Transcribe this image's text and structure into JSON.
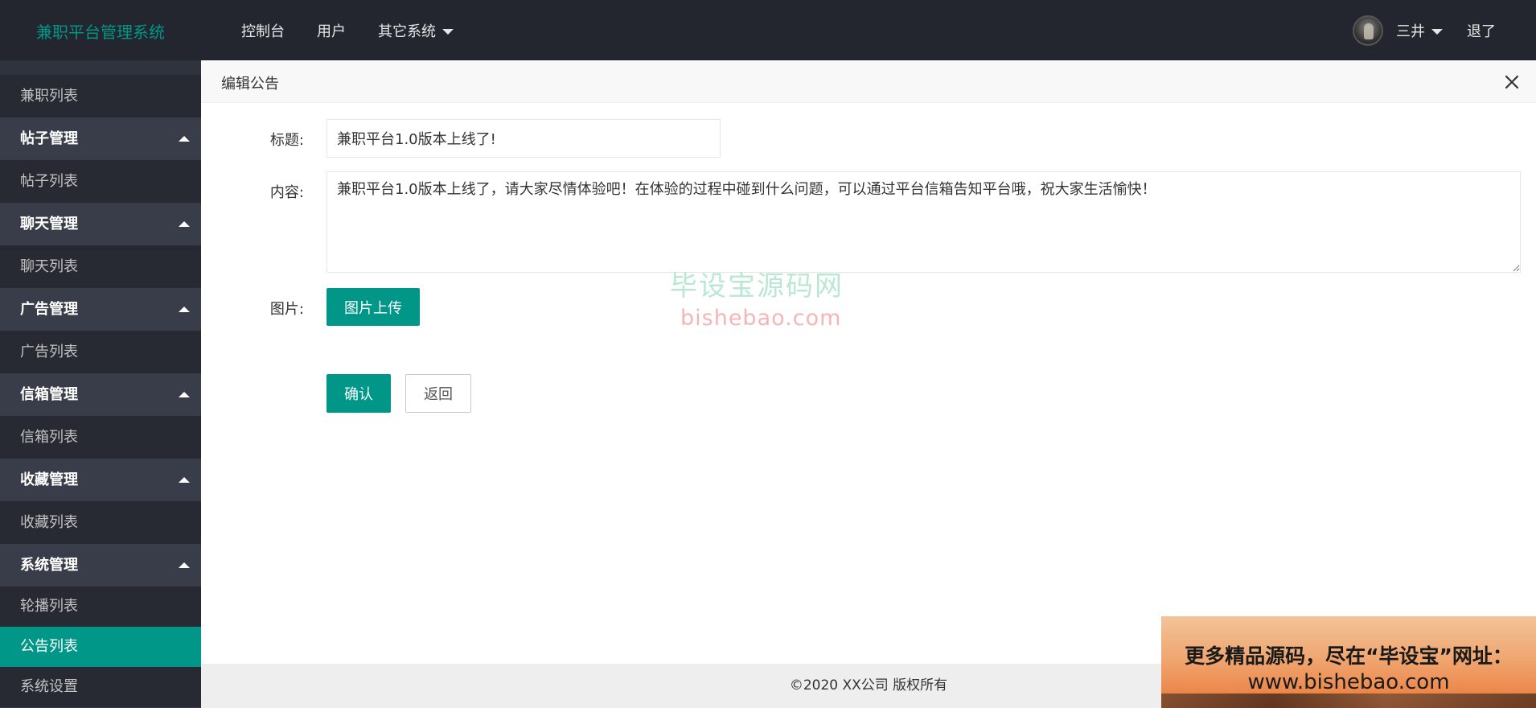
{
  "header": {
    "logo_text": "兼职平台管理系统",
    "nav": [
      {
        "label": "控制台"
      },
      {
        "label": "用户"
      },
      {
        "label": "其它系统"
      }
    ],
    "user_name": "三井",
    "logout_label": "退了"
  },
  "sidebar": {
    "items": [
      {
        "label": "兼职列表"
      },
      {
        "label": "帖子管理"
      },
      {
        "label": "帖子列表"
      },
      {
        "label": "聊天管理"
      },
      {
        "label": "聊天列表"
      },
      {
        "label": "广告管理"
      },
      {
        "label": "广告列表"
      },
      {
        "label": "信箱管理"
      },
      {
        "label": "信箱列表"
      },
      {
        "label": "收藏管理"
      },
      {
        "label": "收藏列表"
      },
      {
        "label": "系统管理"
      },
      {
        "label": "轮播列表"
      },
      {
        "label": "公告列表"
      },
      {
        "label": "系统设置"
      }
    ]
  },
  "panel": {
    "title": "编辑公告",
    "form": {
      "title_label": "标题:",
      "title_value": "兼职平台1.0版本上线了!",
      "content_label": "内容:",
      "content_value": "兼职平台1.0版本上线了，请大家尽情体验吧！在体验的过程中碰到什么问题，可以通过平台信箱告知平台哦，祝大家生活愉快！",
      "image_label": "图片:",
      "upload_label": "图片上传",
      "confirm_label": "确认",
      "back_label": "返回"
    }
  },
  "watermark": {
    "cn": "毕设宝源码网",
    "en": "bishebao.com"
  },
  "footer": {
    "copyright": "©2020 XX公司 版权所有"
  },
  "promo": {
    "line1": "更多精品源码，尽在“毕设宝”网址：",
    "line2": "www.bishebao.com"
  },
  "colors": {
    "accent": "#009688",
    "header_bg": "#23262e",
    "sidebar_bg": "#393d49",
    "sidebar_item_bg": "#272a32"
  }
}
